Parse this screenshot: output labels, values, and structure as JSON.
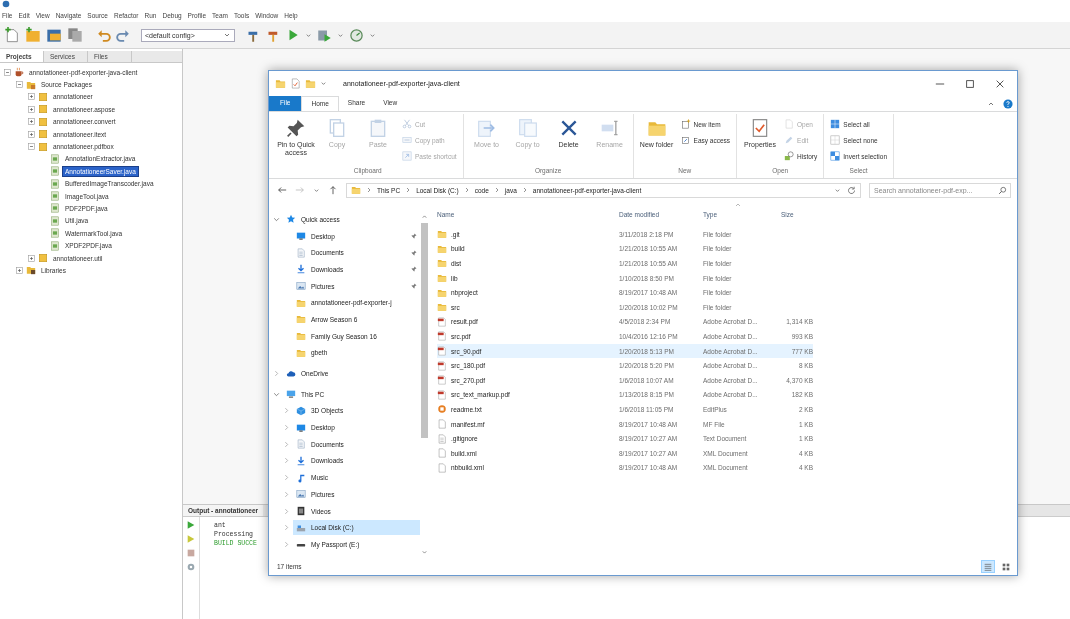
{
  "ide": {
    "menu": [
      "File",
      "Edit",
      "View",
      "Navigate",
      "Source",
      "Refactor",
      "Run",
      "Debug",
      "Profile",
      "Team",
      "Tools",
      "Window",
      "Help"
    ],
    "toolbar": {
      "config": "<default config>"
    },
    "project_tabs": [
      {
        "label": "Projects",
        "selected": true
      },
      {
        "label": "Services",
        "selected": false
      },
      {
        "label": "Files",
        "selected": false
      }
    ],
    "project_tree": [
      {
        "label": "annotationeer-pdf-exporter-java-client",
        "kind": "project",
        "expanded": true,
        "selected": false,
        "children": [
          {
            "label": "Source Packages",
            "kind": "sources",
            "expanded": true,
            "selected": false,
            "children": [
              {
                "label": "annotationeer",
                "kind": "package",
                "expanded": false,
                "selected": false
              },
              {
                "label": "annotationeer.aspose",
                "kind": "package",
                "expanded": false,
                "selected": false
              },
              {
                "label": "annotationeer.convert",
                "kind": "package",
                "expanded": false,
                "selected": false
              },
              {
                "label": "annotationeer.itext",
                "kind": "package",
                "expanded": false,
                "selected": false
              },
              {
                "label": "annotationeer.pdfbox",
                "kind": "package",
                "expanded": true,
                "selected": false,
                "children": [
                  {
                    "label": "AnnotationExtractor.java",
                    "kind": "class",
                    "selected": false
                  },
                  {
                    "label": "AnnotationeerSaver.java",
                    "kind": "class",
                    "selected": true
                  },
                  {
                    "label": "BufferedImageTranscoder.java",
                    "kind": "class",
                    "selected": false
                  },
                  {
                    "label": "ImageTool.java",
                    "kind": "class",
                    "selected": false
                  },
                  {
                    "label": "PDF2PDF.java",
                    "kind": "class",
                    "selected": false
                  },
                  {
                    "label": "Util.java",
                    "kind": "class",
                    "selected": false
                  },
                  {
                    "label": "WatermarkTool.java",
                    "kind": "class",
                    "selected": false
                  },
                  {
                    "label": "XPDF2PDF.java",
                    "kind": "class",
                    "selected": false
                  }
                ]
              },
              {
                "label": "annotationeer.util",
                "kind": "package",
                "expanded": false,
                "selected": false
              }
            ]
          },
          {
            "label": "Libraries",
            "kind": "library",
            "expanded": false,
            "selected": false
          }
        ]
      }
    ],
    "output": {
      "title": "Output - annotationeer",
      "lines": [
        {
          "text": "ant",
          "kind": "plain"
        },
        {
          "text": "Processing",
          "kind": "plain"
        },
        {
          "text": "BUILD SUCCE",
          "kind": "success"
        }
      ]
    }
  },
  "explorer": {
    "title": "annotationeer-pdf-exporter-java-client",
    "ribbon_tabs": [
      {
        "label": "File",
        "kind": "menu",
        "selected": false
      },
      {
        "label": "Home",
        "kind": "tab",
        "selected": true
      },
      {
        "label": "Share",
        "kind": "tab",
        "selected": false
      },
      {
        "label": "View",
        "kind": "tab",
        "selected": false
      }
    ],
    "ribbon_groups": [
      {
        "label": "Clipboard",
        "commands": [
          {
            "label": "Pin to Quick access",
            "kind": "large",
            "disabled": false
          },
          {
            "label": "Copy",
            "kind": "large",
            "disabled": true
          },
          {
            "label": "Paste",
            "kind": "large",
            "disabled": true
          },
          {
            "label": "Cut",
            "kind": "small",
            "disabled": true
          },
          {
            "label": "Copy path",
            "kind": "small",
            "disabled": true
          },
          {
            "label": "Paste shortcut",
            "kind": "small",
            "disabled": true
          }
        ]
      },
      {
        "label": "Organize",
        "commands": [
          {
            "label": "Move to",
            "kind": "large",
            "disabled": true
          },
          {
            "label": "Copy to",
            "kind": "large",
            "disabled": true
          },
          {
            "label": "Delete",
            "kind": "large",
            "disabled": false
          },
          {
            "label": "Rename",
            "kind": "large",
            "disabled": true
          }
        ]
      },
      {
        "label": "New",
        "commands": [
          {
            "label": "New folder",
            "kind": "large",
            "disabled": false
          },
          {
            "label": "New item",
            "kind": "small",
            "disabled": false
          },
          {
            "label": "Easy access",
            "kind": "small",
            "disabled": false
          }
        ]
      },
      {
        "label": "Open",
        "commands": [
          {
            "label": "Properties",
            "kind": "large",
            "disabled": false
          },
          {
            "label": "Open",
            "kind": "small",
            "disabled": true
          },
          {
            "label": "Edit",
            "kind": "small",
            "disabled": true
          },
          {
            "label": "History",
            "kind": "small",
            "disabled": false
          }
        ]
      },
      {
        "label": "Select",
        "commands": [
          {
            "label": "Select all",
            "kind": "small",
            "disabled": false
          },
          {
            "label": "Select none",
            "kind": "small",
            "disabled": false
          },
          {
            "label": "Invert selection",
            "kind": "small",
            "disabled": false
          }
        ]
      }
    ],
    "breadcrumbs": [
      "This PC",
      "Local Disk (C:)",
      "code",
      "java",
      "annotationeer-pdf-exporter-java-client"
    ],
    "search": {
      "placeholder": "Search annotationeer-pdf-exp..."
    },
    "nav": [
      {
        "label": "Quick access",
        "kind": "star",
        "expanded": true,
        "selected": false,
        "children": [
          {
            "label": "Desktop",
            "kind": "desktop",
            "pinned": true,
            "selected": false
          },
          {
            "label": "Documents",
            "kind": "documents",
            "pinned": true,
            "selected": false
          },
          {
            "label": "Downloads",
            "kind": "downloads",
            "pinned": true,
            "selected": false
          },
          {
            "label": "Pictures",
            "kind": "pictures",
            "pinned": true,
            "selected": false
          },
          {
            "label": "annotationeer-pdf-exporter-j",
            "kind": "folder",
            "pinned": false,
            "selected": false
          },
          {
            "label": "Arrow Season 6",
            "kind": "folder",
            "pinned": false,
            "selected": false
          },
          {
            "label": "Family Guy Season 16",
            "kind": "folder",
            "pinned": false,
            "selected": false
          },
          {
            "label": "gbeth",
            "kind": "folder",
            "pinned": false,
            "selected": false
          }
        ]
      },
      {
        "label": "OneDrive",
        "kind": "cloud",
        "expanded": false,
        "selected": false
      },
      {
        "label": "This PC",
        "kind": "computer",
        "expanded": true,
        "selected": false,
        "children": [
          {
            "label": "3D Objects",
            "kind": "objects",
            "expanded": false,
            "selected": false
          },
          {
            "label": "Desktop",
            "kind": "desktop",
            "expanded": false,
            "selected": false
          },
          {
            "label": "Documents",
            "kind": "documents",
            "expanded": false,
            "selected": false
          },
          {
            "label": "Downloads",
            "kind": "downloads",
            "expanded": false,
            "selected": false
          },
          {
            "label": "Music",
            "kind": "music",
            "expanded": false,
            "selected": false
          },
          {
            "label": "Pictures",
            "kind": "pictures",
            "expanded": false,
            "selected": false
          },
          {
            "label": "Videos",
            "kind": "videos",
            "expanded": false,
            "selected": false
          },
          {
            "label": "Local Disk (C:)",
            "kind": "disk",
            "expanded": false,
            "selected": true
          },
          {
            "label": "My Passport (E:)",
            "kind": "drive",
            "expanded": false,
            "selected": false
          }
        ]
      }
    ],
    "columns": [
      "Name",
      "Date modified",
      "Type",
      "Size"
    ],
    "files": [
      {
        "name": ".git",
        "date": "3/11/2018 2:18 PM",
        "type": "File folder",
        "kind": "folder",
        "selected": false
      },
      {
        "name": "build",
        "date": "1/21/2018 10:55 AM",
        "type": "File folder",
        "kind": "folder",
        "selected": false
      },
      {
        "name": "dist",
        "date": "1/21/2018 10:55 AM",
        "type": "File folder",
        "kind": "folder",
        "selected": false
      },
      {
        "name": "lib",
        "date": "1/10/2018 8:50 PM",
        "type": "File folder",
        "kind": "folder",
        "selected": false
      },
      {
        "name": "nbproject",
        "date": "8/19/2017 10:48 AM",
        "type": "File folder",
        "kind": "folder",
        "selected": false
      },
      {
        "name": "src",
        "date": "1/20/2018 10:02 PM",
        "type": "File folder",
        "kind": "folder",
        "selected": false
      },
      {
        "name": "result.pdf",
        "date": "4/5/2018 2:34 PM",
        "type": "Adobe Acrobat D...",
        "size": "1,314 KB",
        "kind": "pdf",
        "selected": false
      },
      {
        "name": "src.pdf",
        "date": "10/4/2016 12:16 PM",
        "type": "Adobe Acrobat D...",
        "size": "993 KB",
        "kind": "pdf",
        "selected": false
      },
      {
        "name": "src_90.pdf",
        "date": "1/20/2018 5:13 PM",
        "type": "Adobe Acrobat D...",
        "size": "777 KB",
        "kind": "pdf",
        "selected": true
      },
      {
        "name": "src_180.pdf",
        "date": "1/20/2018 5:20 PM",
        "type": "Adobe Acrobat D...",
        "size": "8 KB",
        "kind": "pdf",
        "selected": false
      },
      {
        "name": "src_270.pdf",
        "date": "1/6/2018 10:07 AM",
        "type": "Adobe Acrobat D...",
        "size": "4,370 KB",
        "kind": "pdf",
        "selected": false
      },
      {
        "name": "src_text_markup.pdf",
        "date": "1/13/2018 8:15 PM",
        "type": "Adobe Acrobat D...",
        "size": "182 KB",
        "kind": "pdf",
        "selected": false
      },
      {
        "name": "readme.txt",
        "date": "1/6/2018 11:05 PM",
        "type": "EditPlus",
        "size": "2 KB",
        "kind": "editplus",
        "selected": false
      },
      {
        "name": "manifest.mf",
        "date": "8/19/2017 10:48 AM",
        "type": "MF File",
        "size": "1 KB",
        "kind": "file",
        "selected": false
      },
      {
        "name": ".gitignore",
        "date": "8/19/2017 10:27 AM",
        "type": "Text Document",
        "size": "1 KB",
        "kind": "text",
        "selected": false
      },
      {
        "name": "build.xml",
        "date": "8/19/2017 10:27 AM",
        "type": "XML Document",
        "size": "4 KB",
        "kind": "file",
        "selected": false
      },
      {
        "name": "nbbuild.xml",
        "date": "8/19/2017 10:48 AM",
        "type": "XML Document",
        "size": "4 KB",
        "kind": "file",
        "selected": false
      }
    ],
    "status": "17 items",
    "views": [
      {
        "selected": true
      },
      {
        "selected": false
      }
    ]
  }
}
